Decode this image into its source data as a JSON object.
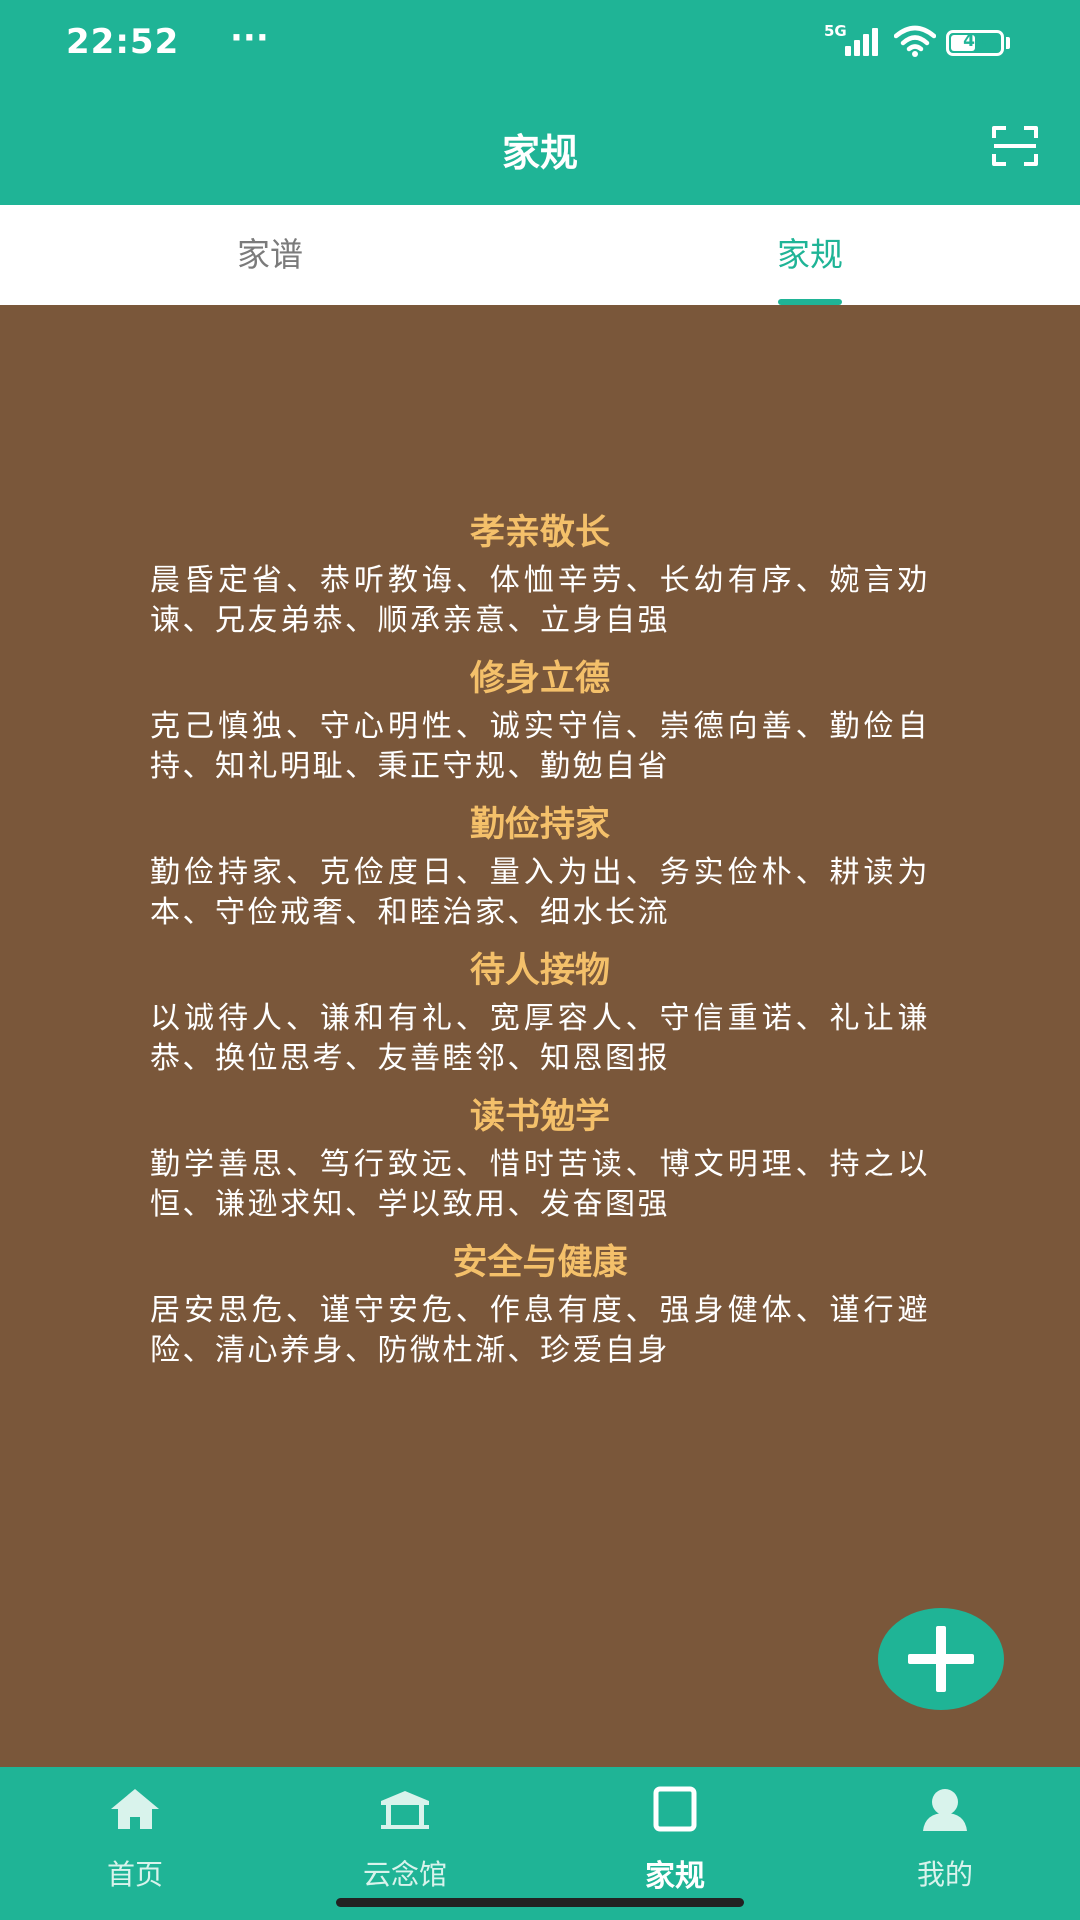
{
  "status_bar": {
    "time": "22:52",
    "more": "···",
    "network": "5G",
    "battery": "41"
  },
  "header": {
    "title": "家规"
  },
  "tabs": [
    {
      "label": "家谱",
      "active": false
    },
    {
      "label": "家规",
      "active": true
    }
  ],
  "rules": [
    {
      "title": "孝亲敬长",
      "body": "晨昏定省、恭听教诲、体恤辛劳、长幼有序、婉言劝谏、兄友弟恭、顺承亲意、立身自强"
    },
    {
      "title": "修身立德",
      "body": "克己慎独、守心明性、诚实守信、崇德向善、勤俭自持、知礼明耻、秉正守规、勤勉自省"
    },
    {
      "title": "勤俭持家",
      "body": "勤俭持家、克俭度日、量入为出、务实俭朴、耕读为本、守俭戒奢、和睦治家、细水长流"
    },
    {
      "title": "待人接物",
      "body": "以诚待人、谦和有礼、宽厚容人、守信重诺、礼让谦恭、换位思考、友善睦邻、知恩图报"
    },
    {
      "title": "读书勉学",
      "body": "勤学善思、笃行致远、惜时苦读、博文明理、持之以恒、谦逊求知、学以致用、发奋图强"
    },
    {
      "title": "安全与健康",
      "body": "居安思危、谨守安危、作息有度、强身健体、谨行避险、清心养身、防微杜渐、珍爱自身"
    }
  ],
  "bottom_nav": [
    {
      "label": "首页",
      "icon": "home-icon",
      "active": false
    },
    {
      "label": "云念馆",
      "icon": "memorial-hall-icon",
      "active": false
    },
    {
      "label": "家规",
      "icon": "square-icon",
      "active": true
    },
    {
      "label": "我的",
      "icon": "profile-icon",
      "active": false
    }
  ],
  "colors": {
    "primary": "#1fb496",
    "background": "#7a573a",
    "section_title": "#f4c06a"
  }
}
